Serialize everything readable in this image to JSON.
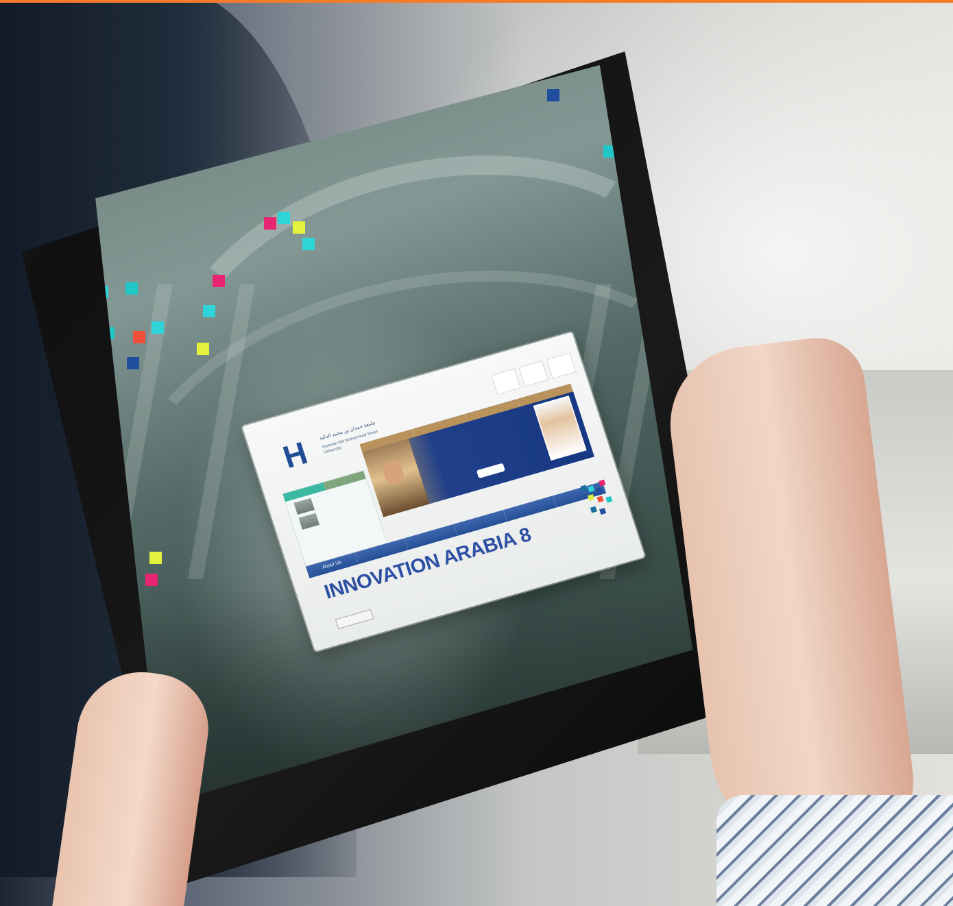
{
  "site": {
    "header": {
      "top_utility_text": "",
      "logo_arabic": "جامعة حمدان بن محمد الذكية",
      "logo_english": "Hamdan Bin Mohammed Smart University",
      "quick_links": [
        "",
        "",
        ""
      ]
    },
    "hero": {
      "tabs": [
        "",
        "",
        "",
        ""
      ],
      "text_line_1": "",
      "text_line_2": "",
      "text_line_3": "",
      "button_label": ""
    },
    "news_box": {
      "tabs": [
        "",
        ""
      ],
      "items": [
        "",
        ""
      ]
    },
    "nav": [
      "About Us",
      "",
      "",
      "",
      "",
      ""
    ],
    "headline": "INNOVATION ARABIA 8",
    "subline": "",
    "register_label": "",
    "footer": ""
  },
  "palette": {
    "accent_orange": "#f47b2a",
    "site_blue": "#244f97",
    "teal": "#3bb8a2",
    "gold": "#c7aa63"
  },
  "icons": {
    "brand": "h-logo-icon"
  }
}
